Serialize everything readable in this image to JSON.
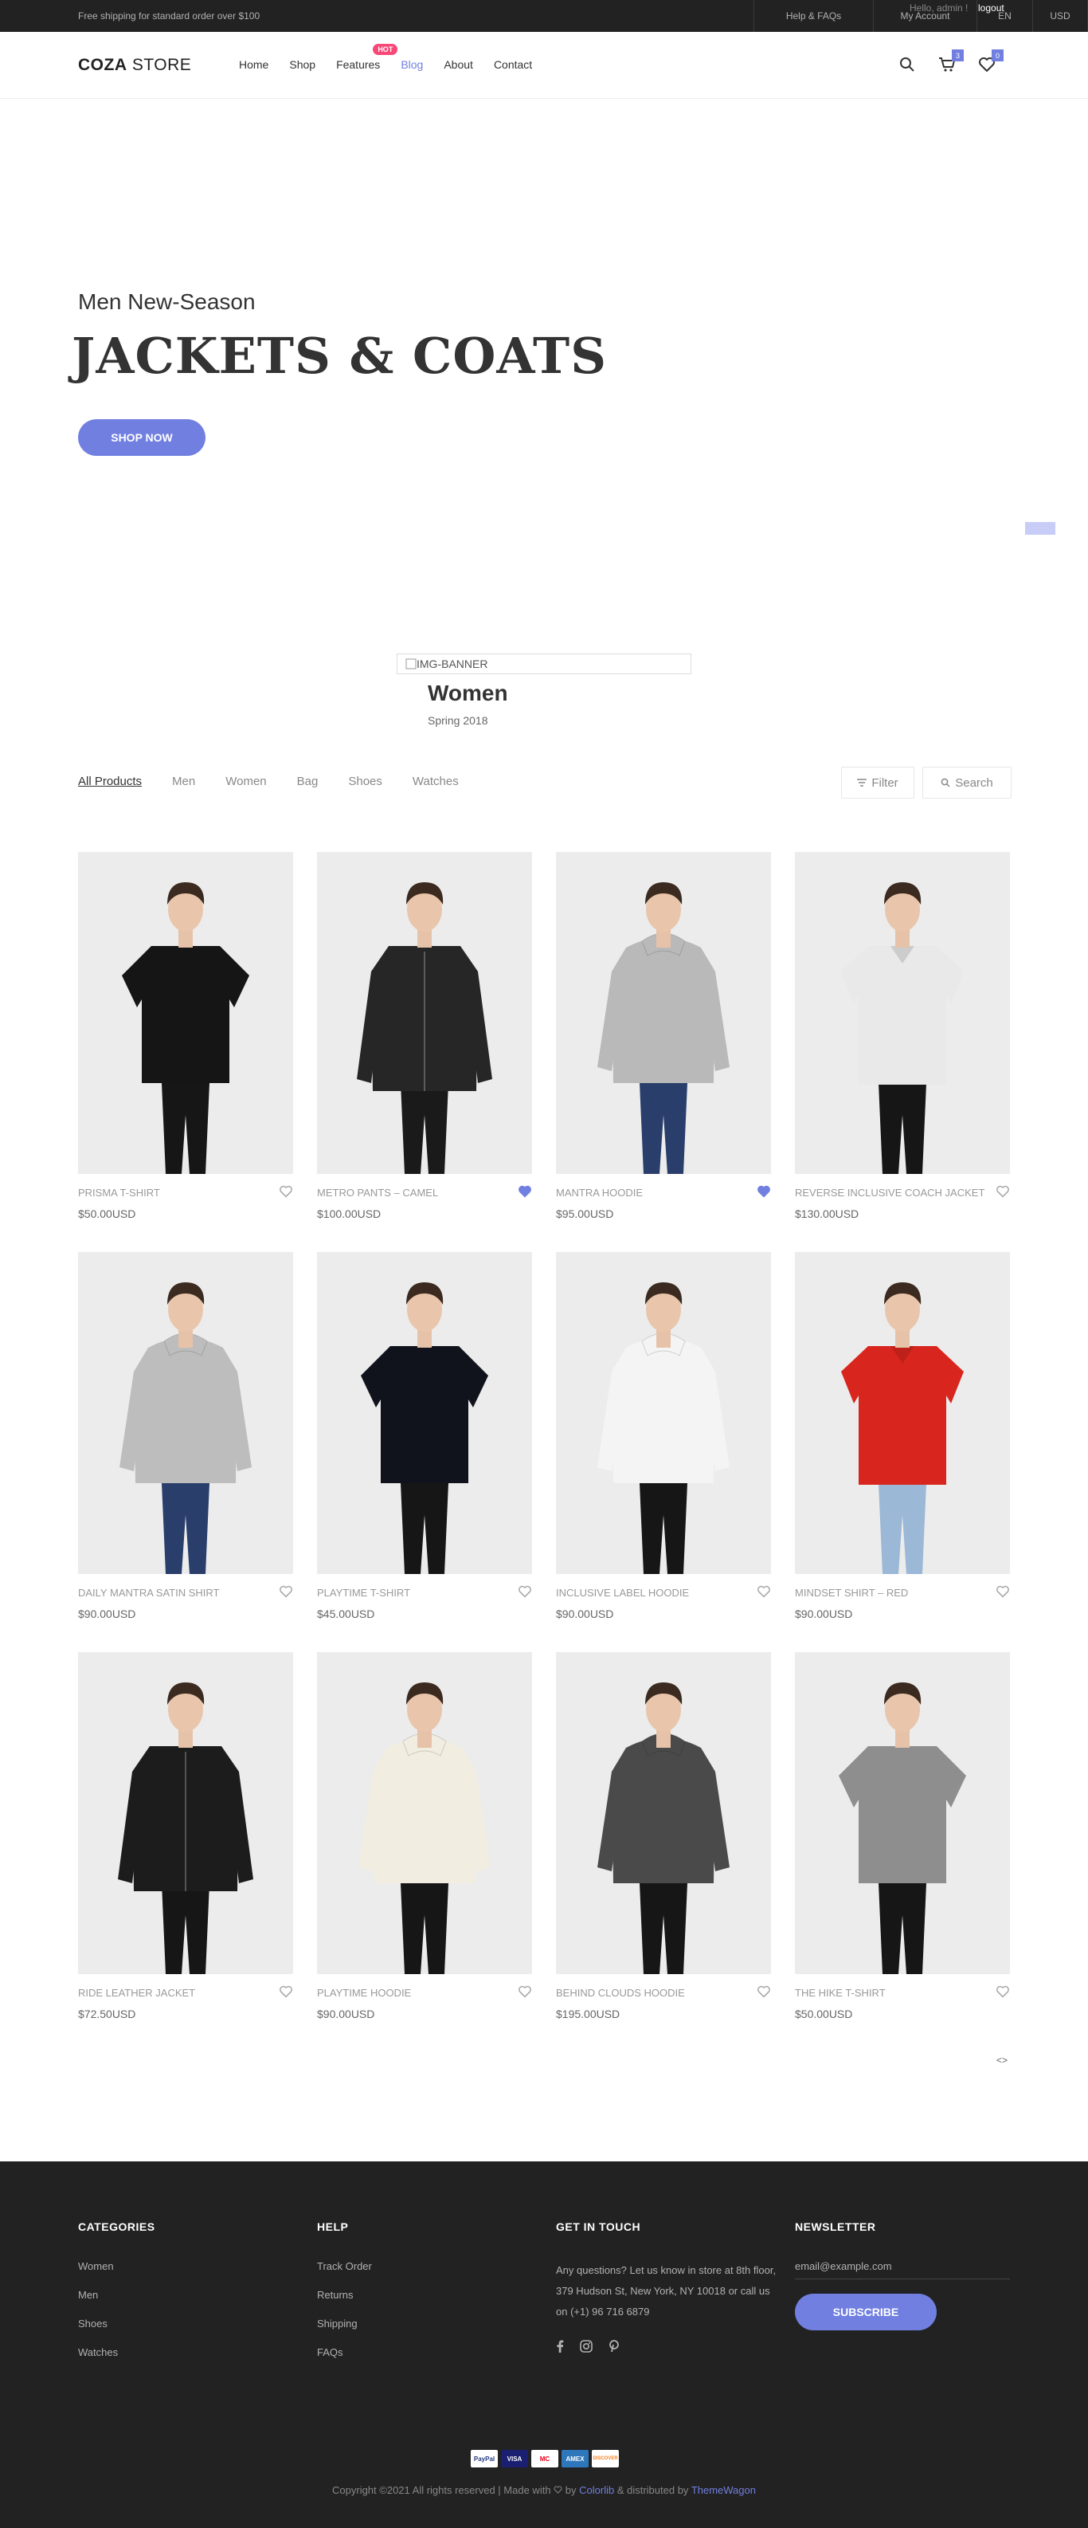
{
  "topbar": {
    "shipping": "Free shipping for standard order over $100",
    "links": [
      "Help & FAQs",
      "My Account",
      "EN",
      "USD"
    ],
    "hello": "Hello, admin !",
    "logout": "logout"
  },
  "header": {
    "logo_bold": "COZA",
    "logo_rest": " STORE",
    "nav": [
      "Home",
      "Shop",
      "Features",
      "Blog",
      "About",
      "Contact"
    ],
    "hot_label": "HOT",
    "cart_count": "3",
    "wishlist_count": "0"
  },
  "hero": {
    "subtitle": "Men New-Season",
    "title": "JACKETS & COATS",
    "button": "SHOP NOW"
  },
  "banner": {
    "img_alt": "IMG-BANNER",
    "title": "Women",
    "subtitle": "Spring 2018"
  },
  "filters": {
    "items": [
      "All Products",
      "Men",
      "Women",
      "Bag",
      "Shoes",
      "Watches"
    ],
    "filter_label": "Filter",
    "search_label": "Search"
  },
  "products": [
    {
      "name": "PRISMA T-SHIRT",
      "price": "$50.00USD",
      "liked": false,
      "garment": "#151515",
      "legs": "#161616",
      "type": "tee"
    },
    {
      "name": "METRO PANTS – CAMEL",
      "price": "$100.00USD",
      "liked": true,
      "garment": "#262626",
      "legs": "#1a1a1a",
      "type": "jacket"
    },
    {
      "name": "MANTRA HOODIE",
      "price": "$95.00USD",
      "liked": true,
      "garment": "#b9b9b9",
      "legs": "#2a3e6b",
      "type": "hoodie"
    },
    {
      "name": "REVERSE INCLUSIVE COACH JACKET",
      "price": "$130.00USD",
      "liked": false,
      "garment": "#e9e9e9",
      "legs": "#161616",
      "type": "shirt"
    },
    {
      "name": "DAILY MANTRA SATIN SHIRT",
      "price": "$90.00USD",
      "liked": false,
      "garment": "#bdbdbd",
      "legs": "#2a3e6b",
      "type": "hoodie"
    },
    {
      "name": "PLAYTIME T-SHIRT",
      "price": "$45.00USD",
      "liked": false,
      "garment": "#10121c",
      "legs": "#161616",
      "type": "tee"
    },
    {
      "name": "INCLUSIVE LABEL HOODIE",
      "price": "$90.00USD",
      "liked": false,
      "garment": "#f4f4f4",
      "legs": "#161616",
      "type": "hoodie"
    },
    {
      "name": "MINDSET SHIRT – RED",
      "price": "$90.00USD",
      "liked": false,
      "garment": "#d8261e",
      "legs": "#9bb8d6",
      "type": "shirt"
    },
    {
      "name": "RIDE LEATHER JACKET",
      "price": "$72.50USD",
      "liked": false,
      "garment": "#1c1c1c",
      "legs": "#161616",
      "type": "jacket"
    },
    {
      "name": "PLAYTIME HOODIE",
      "price": "$90.00USD",
      "liked": false,
      "garment": "#f1ede0",
      "legs": "#161616",
      "type": "hoodie"
    },
    {
      "name": "BEHIND CLOUDS HOODIE",
      "price": "$195.00USD",
      "liked": false,
      "garment": "#4a4a4a",
      "legs": "#161616",
      "type": "hoodie"
    },
    {
      "name": "THE HIKE T-SHIRT",
      "price": "$50.00USD",
      "liked": false,
      "garment": "#8e8e8e",
      "legs": "#161616",
      "type": "tee"
    }
  ],
  "pager": "<>",
  "footer": {
    "categories_title": "CATEGORIES",
    "categories": [
      "Women",
      "Men",
      "Shoes",
      "Watches"
    ],
    "help_title": "HELP",
    "help": [
      "Track Order",
      "Returns",
      "Shipping",
      "FAQs"
    ],
    "touch_title": "GET IN TOUCH",
    "touch_text": "Any questions? Let us know in store at 8th floor, 379 Hudson St, New York, NY 10018 or call us on (+1) 96 716 6879",
    "newsletter_title": "NEWSLETTER",
    "newsletter_placeholder": "email@example.com",
    "subscribe": "SUBSCRIBE",
    "payments": [
      "PayPal",
      "VISA",
      "MC",
      "AMEX",
      "DISCOVER"
    ],
    "copy_a": "Copyright ©2021 All rights reserved | Made with ",
    "copy_b": " by ",
    "copy_colorlib": "Colorlib",
    "copy_c": " & distributed by ",
    "copy_themewagon": "ThemeWagon"
  },
  "colors": {
    "accent": "#717fe0",
    "dark": "#222222",
    "hot": "#f74877"
  }
}
